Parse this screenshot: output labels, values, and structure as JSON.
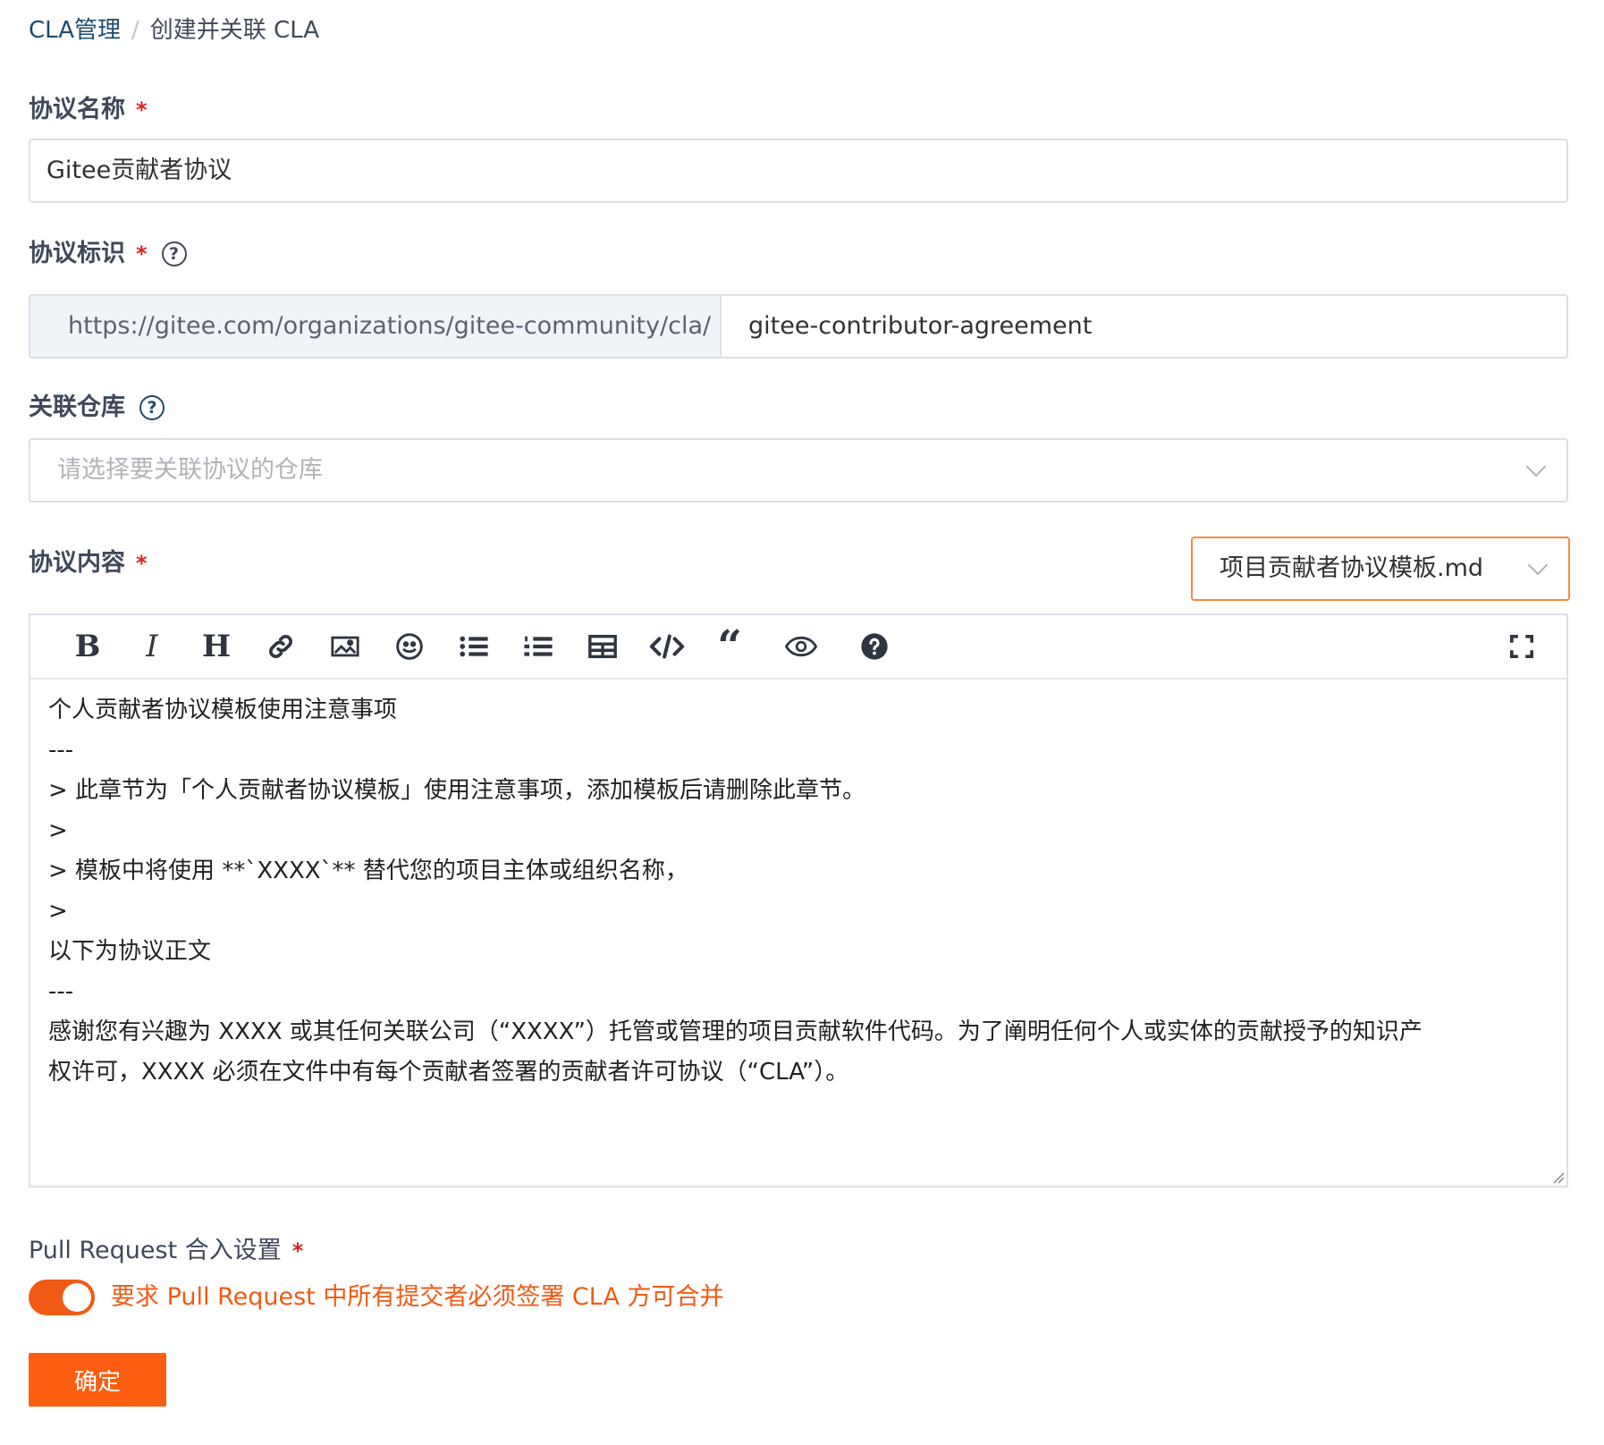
{
  "breadcrumb": {
    "parent": "CLA管理",
    "separator": "/",
    "current": "创建并关联 CLA"
  },
  "fields": {
    "name": {
      "label": "协议名称",
      "value": "Gitee贡献者协议"
    },
    "identifier": {
      "label": "协议标识",
      "prefix": "https://gitee.com/organizations/gitee-community/cla/",
      "value": "gitee-contributor-agreement"
    },
    "repo": {
      "label": "关联仓库",
      "placeholder": "请选择要关联协议的仓库"
    },
    "content": {
      "label": "协议内容",
      "template": "项目贡献者协议模板.md"
    },
    "pr": {
      "label": "Pull Request 合入设置",
      "toggle_text": "要求 Pull Request 中所有提交者必须签署 CLA 方可合并",
      "enabled": true
    }
  },
  "required_mark": "*",
  "help_mark": "?",
  "editor_lines": [
    "个人贡献者协议模板使用注意事项",
    "---",
    "",
    "> 此章节为「个人贡献者协议模板」使用注意事项，添加模板后请删除此章节。",
    ">",
    "> 模板中将使用 **`XXXX`** 替代您的项目主体或组织名称，",
    ">",
    "",
    "以下为协议正文",
    "---",
    "",
    "感谢您有兴趣为 XXXX 或其任何关联公司（“XXXX”）托管或管理的项目贡献软件代码。为了阐明任何个人或实体的贡献授予的知识产",
    "权许可，XXXX 必须在文件中有每个贡献者签署的贡献者许可协议（“CLA”）。"
  ],
  "toolbar_icons": [
    "bold-icon",
    "italic-icon",
    "heading-icon",
    "link-icon",
    "image-icon",
    "emoji-icon",
    "bullet-list-icon",
    "numbered-list-icon",
    "table-icon",
    "code-icon",
    "quote-icon",
    "preview-icon",
    "help-icon",
    "fullscreen-icon"
  ],
  "submit_label": "确定",
  "colors": {
    "accent": "#fb5e10",
    "link": "#1b4b72",
    "focus_border": "#f68b3c",
    "required": "#e02020"
  }
}
